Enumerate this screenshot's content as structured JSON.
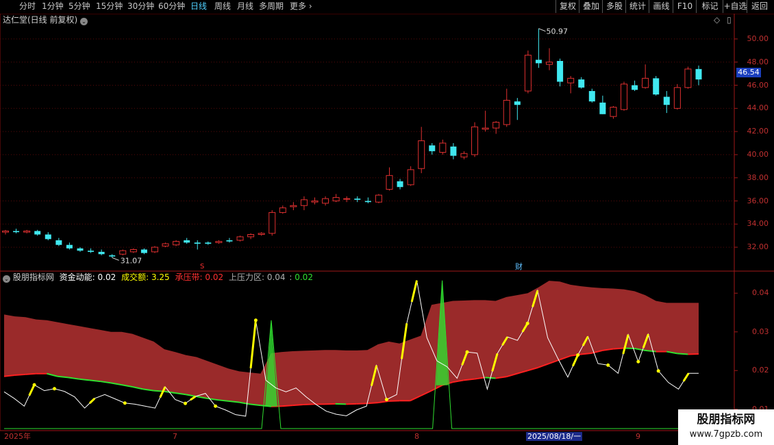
{
  "toolbar": {
    "periods": [
      "分时",
      "1分钟",
      "5分钟",
      "15分钟",
      "30分钟",
      "60分钟",
      "日线",
      "周线",
      "月线",
      "多周期",
      "更多"
    ],
    "active_period": "日线",
    "buttons": [
      "复权",
      "叠加",
      "多股",
      "统计",
      "画线",
      "F10",
      "标记",
      "+自选",
      "返回"
    ]
  },
  "main_pane": {
    "title": "达仁堂(日线 前复权)",
    "price_labels": [
      "50.00",
      "48.00",
      "46.00",
      "44.00",
      "42.00",
      "40.00",
      "38.00",
      "36.00",
      "34.00",
      "32.00"
    ],
    "current_price": "46.54",
    "high_annotation": "50.97",
    "low_annotation": "31.07",
    "marker_s": "S",
    "marker_cai": "财"
  },
  "indicator_pane": {
    "name": "股朋指标网",
    "zjdn_label": "资金动能:",
    "zjdn_value": "0.02",
    "cje_label": "成交额:",
    "cje_value": "3.25",
    "cyd_label": "承压带:",
    "cyd_value": "0.02",
    "sylq_label": "上压力区:",
    "sylq_value": "0.04",
    "last_value": "0.02",
    "scale_labels": [
      "0.04",
      "0.03",
      "0.02",
      "0.01"
    ]
  },
  "date_axis": {
    "labels": [
      "2025年",
      "7",
      "8",
      "9"
    ],
    "highlight": "2025/08/18/一"
  },
  "watermark": {
    "line1": "股朋指标网",
    "line2": "www.7gpzb.com"
  },
  "colors": {
    "up": "#e03030",
    "down": "#40e8f0",
    "band": "#9a2a2a",
    "signal": "#ffff00",
    "green": "#30e030"
  },
  "chart_data": {
    "type": "candlestick",
    "price_axis": [
      31,
      51
    ],
    "candles": [
      [
        33.3,
        33.5,
        33.1,
        33.4
      ],
      [
        33.4,
        33.6,
        33.2,
        33.3
      ],
      [
        33.3,
        33.5,
        33.2,
        33.4
      ],
      [
        33.4,
        33.5,
        33.0,
        33.1
      ],
      [
        33.1,
        33.3,
        32.6,
        32.7
      ],
      [
        32.6,
        32.8,
        32.1,
        32.2
      ],
      [
        32.2,
        32.4,
        31.8,
        31.9
      ],
      [
        31.9,
        32.0,
        31.6,
        31.7
      ],
      [
        31.7,
        31.9,
        31.5,
        31.6
      ],
      [
        31.6,
        31.8,
        31.3,
        31.4
      ],
      [
        31.3,
        31.4,
        31.1,
        31.2
      ],
      [
        31.4,
        31.8,
        31.3,
        31.7
      ],
      [
        31.6,
        31.9,
        31.5,
        31.8
      ],
      [
        31.8,
        31.9,
        31.4,
        31.5
      ],
      [
        31.6,
        32.1,
        31.5,
        32.0
      ],
      [
        32.1,
        32.4,
        32.0,
        32.3
      ],
      [
        32.2,
        32.6,
        32.1,
        32.5
      ],
      [
        32.6,
        32.8,
        32.3,
        32.4
      ],
      [
        32.4,
        32.6,
        31.8,
        32.3
      ],
      [
        32.4,
        32.5,
        32.2,
        32.3
      ],
      [
        32.4,
        32.6,
        32.3,
        32.5
      ],
      [
        32.6,
        32.8,
        32.4,
        32.5
      ],
      [
        32.6,
        33.0,
        32.5,
        32.9
      ],
      [
        32.9,
        33.2,
        32.7,
        33.1
      ],
      [
        33.1,
        33.3,
        33.0,
        33.2
      ],
      [
        33.2,
        35.2,
        33.0,
        35.0
      ],
      [
        35.0,
        35.6,
        34.9,
        35.4
      ],
      [
        35.5,
        35.9,
        35.2,
        35.6
      ],
      [
        35.6,
        36.4,
        35.2,
        36.1
      ],
      [
        35.9,
        36.3,
        35.7,
        36.0
      ],
      [
        35.8,
        36.4,
        35.6,
        36.2
      ],
      [
        36.0,
        36.6,
        35.9,
        36.3
      ],
      [
        36.2,
        36.4,
        35.9,
        36.2
      ],
      [
        36.2,
        36.4,
        35.9,
        36.1
      ],
      [
        36.0,
        36.3,
        35.8,
        35.9
      ],
      [
        35.9,
        36.6,
        35.8,
        36.5
      ],
      [
        37.0,
        38.9,
        36.9,
        38.2
      ],
      [
        37.7,
        37.9,
        37.0,
        37.2
      ],
      [
        37.4,
        39.0,
        37.3,
        38.7
      ],
      [
        38.8,
        42.4,
        38.4,
        41.2
      ],
      [
        40.8,
        41.0,
        40.0,
        40.3
      ],
      [
        40.2,
        41.3,
        40.0,
        41.0
      ],
      [
        40.7,
        41.0,
        39.6,
        39.9
      ],
      [
        39.8,
        40.3,
        39.6,
        40.1
      ],
      [
        40.0,
        42.8,
        39.8,
        42.4
      ],
      [
        42.2,
        43.8,
        42.0,
        42.3
      ],
      [
        42.3,
        42.9,
        41.8,
        42.8
      ],
      [
        42.6,
        45.7,
        42.4,
        44.7
      ],
      [
        44.6,
        44.9,
        43.0,
        44.3
      ],
      [
        45.5,
        49.0,
        45.3,
        48.6
      ],
      [
        48.2,
        50.9,
        47.5,
        47.9
      ],
      [
        47.8,
        49.2,
        47.3,
        48.0
      ],
      [
        48.1,
        48.3,
        45.9,
        46.3
      ],
      [
        46.2,
        46.8,
        45.3,
        46.6
      ],
      [
        46.5,
        46.7,
        45.7,
        45.8
      ],
      [
        45.5,
        45.7,
        44.5,
        44.6
      ],
      [
        44.5,
        45.1,
        43.5,
        43.5
      ],
      [
        43.3,
        44.2,
        43.1,
        44.1
      ],
      [
        43.9,
        46.3,
        43.8,
        46.1
      ],
      [
        46.0,
        46.4,
        45.5,
        45.6
      ],
      [
        45.8,
        47.8,
        45.7,
        46.6
      ],
      [
        46.6,
        46.8,
        45.1,
        45.2
      ],
      [
        45.0,
        45.5,
        43.6,
        44.3
      ],
      [
        44.0,
        46.1,
        43.9,
        45.8
      ],
      [
        45.8,
        47.6,
        45.7,
        47.4
      ],
      [
        47.4,
        47.7,
        46.0,
        46.5
      ]
    ],
    "indicator": {
      "y_axis": [
        0.005,
        0.045
      ],
      "upper_band": [
        0.0345,
        0.034,
        0.0338,
        0.0332,
        0.033,
        0.0325,
        0.032,
        0.0315,
        0.031,
        0.0305,
        0.03,
        0.03,
        0.0295,
        0.0285,
        0.0275,
        0.0255,
        0.0248,
        0.024,
        0.0235,
        0.0225,
        0.0215,
        0.0205,
        0.0198,
        0.0195,
        0.0192,
        0.0245,
        0.0248,
        0.025,
        0.0251,
        0.0252,
        0.0253,
        0.0253,
        0.0252,
        0.0252,
        0.0253,
        0.0268,
        0.0275,
        0.027,
        0.028,
        0.029,
        0.037,
        0.0375,
        0.038,
        0.0381,
        0.0382,
        0.0382,
        0.038,
        0.039,
        0.0395,
        0.04,
        0.0415,
        0.0432,
        0.043,
        0.0422,
        0.0418,
        0.0415,
        0.0413,
        0.0412,
        0.041,
        0.0405,
        0.0395,
        0.038,
        0.0375,
        0.0375,
        0.0375,
        0.0375
      ],
      "lower_band": [
        0.0185,
        0.0188,
        0.019,
        0.0192,
        0.0192,
        0.0185,
        0.0182,
        0.0178,
        0.0175,
        0.0172,
        0.0168,
        0.0163,
        0.0158,
        0.0152,
        0.0148,
        0.0146,
        0.0142,
        0.0138,
        0.0133,
        0.0128,
        0.0124,
        0.0121,
        0.0118,
        0.0113,
        0.011,
        0.0107,
        0.0108,
        0.011,
        0.0112,
        0.0113,
        0.0113,
        0.0114,
        0.0113,
        0.0114,
        0.0115,
        0.0117,
        0.0121,
        0.0122,
        0.0122,
        0.0135,
        0.0148,
        0.0162,
        0.017,
        0.0175,
        0.0178,
        0.0182,
        0.018,
        0.0184,
        0.0192,
        0.02,
        0.0208,
        0.0218,
        0.0228,
        0.0238,
        0.0242,
        0.0245,
        0.0252,
        0.0256,
        0.0258,
        0.0257,
        0.0252,
        0.0249,
        0.0249,
        0.0244,
        0.0242,
        0.0243
      ],
      "white_line": [
        0.0145,
        0.0128,
        0.0108,
        0.0163,
        0.0148,
        0.0153,
        0.0146,
        0.0132,
        0.0103,
        0.0128,
        0.0138,
        0.0127,
        0.0116,
        0.0113,
        0.0108,
        0.0103,
        0.0158,
        0.0125,
        0.0115,
        0.0133,
        0.0141,
        0.0108,
        0.0098,
        0.0086,
        0.0082,
        0.033,
        0.0175,
        0.0155,
        0.0145,
        0.0155,
        0.0132,
        0.0112,
        0.0095,
        0.0087,
        0.0083,
        0.0098,
        0.0108,
        0.0213,
        0.0125,
        0.0138,
        0.0322,
        0.0433,
        0.0285,
        0.0225,
        0.021,
        0.018,
        0.0248,
        0.0245,
        0.0152,
        0.0244,
        0.0287,
        0.0278,
        0.0322,
        0.0407,
        0.0285,
        0.0232,
        0.0183,
        0.024,
        0.0288,
        0.0218,
        0.0214,
        0.0193,
        0.0293,
        0.0223,
        0.0294,
        0.0199,
        0.0169,
        0.0152,
        0.0193,
        0.0193
      ],
      "spikes": [
        {
          "i": 25,
          "v": 0.033
        },
        {
          "i": 41,
          "v": 0.0433
        }
      ]
    }
  }
}
